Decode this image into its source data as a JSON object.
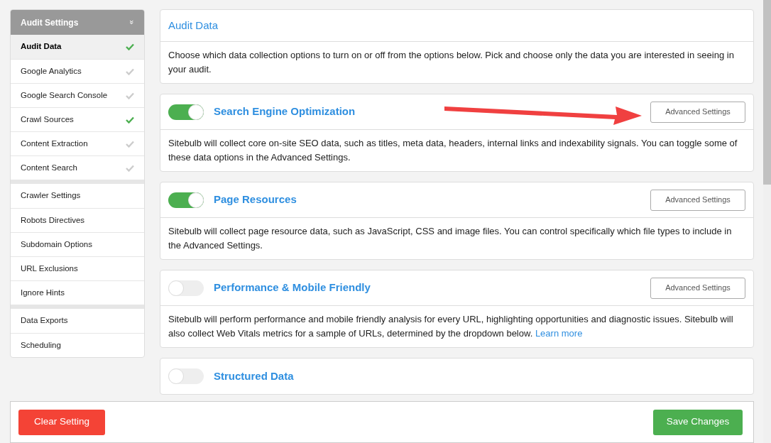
{
  "sidebar": {
    "header": "Audit Settings",
    "header_icon": "»",
    "groups": [
      {
        "items": [
          {
            "label": "Audit Data",
            "selected": true,
            "checked": true
          },
          {
            "label": "Google Analytics",
            "selected": false,
            "checked": false
          },
          {
            "label": "Google Search Console",
            "selected": false,
            "checked": false
          },
          {
            "label": "Crawl Sources",
            "selected": false,
            "checked": true
          },
          {
            "label": "Content Extraction",
            "selected": false,
            "checked": false
          },
          {
            "label": "Content Search",
            "selected": false,
            "checked": false
          }
        ]
      },
      {
        "items": [
          {
            "label": "Crawler Settings",
            "selected": false
          },
          {
            "label": "Robots Directives",
            "selected": false
          },
          {
            "label": "Subdomain Options",
            "selected": false
          },
          {
            "label": "URL Exclusions",
            "selected": false
          },
          {
            "label": "Ignore Hints",
            "selected": false
          }
        ]
      },
      {
        "items": [
          {
            "label": "Data Exports",
            "selected": false
          },
          {
            "label": "Scheduling",
            "selected": false
          }
        ]
      }
    ]
  },
  "intro": {
    "title": "Audit Data",
    "text": "Choose which data collection options to turn on or off from the options below. Pick and choose only the data you are interested in seeing in your audit."
  },
  "sections": [
    {
      "title": "Search Engine Optimization",
      "on": true,
      "button": "Advanced Settings",
      "text": "Sitebulb will collect core on-site SEO data, such as titles, meta data, headers, internal links and indexability signals. You can toggle some of these data options in the Advanced Settings."
    },
    {
      "title": "Page Resources",
      "on": true,
      "button": "Advanced Settings",
      "text": "Sitebulb will collect page resource data, such as JavaScript, CSS and image files. You can control specifically which file types to include in the Advanced Settings."
    },
    {
      "title": "Performance & Mobile Friendly",
      "on": false,
      "button": "Advanced Settings",
      "text": "Sitebulb will perform performance and mobile friendly analysis for every URL, highlighting opportunities and diagnostic issues. Sitebulb will also collect Web Vitals metrics for a sample of URLs, determined by the dropdown below.",
      "link": "Learn more"
    },
    {
      "title": "Structured Data",
      "on": false
    }
  ],
  "footer": {
    "clear": "Clear Setting",
    "save": "Save Changes"
  }
}
